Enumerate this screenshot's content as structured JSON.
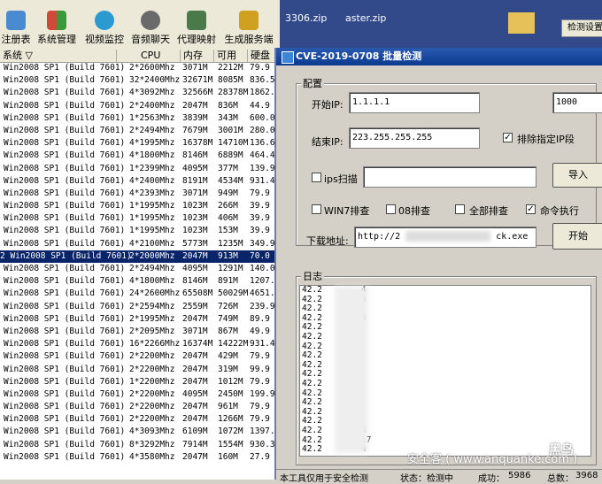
{
  "toolbar": {
    "items": [
      {
        "label": "注册表",
        "icon": "registry-icon",
        "color": "#4a8ad0"
      },
      {
        "label": "系统管理",
        "icon": "windows-logo-icon",
        "color": "#d04a3a"
      },
      {
        "label": "视频监控",
        "icon": "camera-icon",
        "color": "#2a9ad0"
      },
      {
        "label": "音频聊天",
        "icon": "headset-icon",
        "color": "#6a6a6a"
      },
      {
        "label": "代理映射",
        "icon": "proxy-icon",
        "color": "#4a7a4a"
      },
      {
        "label": "生成服务端",
        "icon": "build-icon",
        "color": "#d0a020"
      }
    ]
  },
  "table": {
    "headers": [
      "系统",
      "CPU",
      "内存",
      "可用",
      "硬盘"
    ],
    "sort_indicator": "▽",
    "rows": [
      [
        "Win2008 SP1 (Build 7601)",
        "2*2600Mhz",
        "3071M",
        "2212M",
        "79.9"
      ],
      [
        "Win2008 SP1 (Build 7601)",
        "32*2400Mhz",
        "32671M",
        "8085M",
        "836.5"
      ],
      [
        "Win2008 SP1 (Build 7601)",
        "4*3092Mhz",
        "32566M",
        "28378M",
        "1862.4"
      ],
      [
        "Win2008 SP1 (Build 7601)",
        "2*2400Mhz",
        "2047M",
        "836M",
        "44.9"
      ],
      [
        "Win2008 SP1 (Build 7601)",
        "1*2563Mhz",
        "3839M",
        "343M",
        "600.0"
      ],
      [
        "Win2008 SP1 (Build 7601)",
        "2*2494Mhz",
        "7679M",
        "3001M",
        "280.0"
      ],
      [
        "Win2008 SP1 (Build 7601)",
        "4*1995Mhz",
        "16378M",
        "14710M",
        "136.6"
      ],
      [
        "Win2008 SP1 (Build 7601)",
        "4*1800Mhz",
        "8146M",
        "6889M",
        "464.4"
      ],
      [
        "Win2008 SP1 (Build 7601)",
        "1*2399Mhz",
        "4095M",
        "377M",
        "139.9"
      ],
      [
        "Win2008 SP1 (Build 7601)",
        "4*2400Mhz",
        "8191M",
        "4534M",
        "931.4"
      ],
      [
        "Win2008 SP1 (Build 7601)",
        "4*2393Mhz",
        "3071M",
        "949M",
        "79.9"
      ],
      [
        "Win2008 SP1 (Build 7601)",
        "1*1995Mhz",
        "1023M",
        "266M",
        "39.9"
      ],
      [
        "Win2008 SP1 (Build 7601)",
        "1*1995Mhz",
        "1023M",
        "406M",
        "39.9"
      ],
      [
        "Win2008 SP1 (Build 7601)",
        "1*1995Mhz",
        "1023M",
        "153M",
        "39.9"
      ],
      [
        "Win2008 SP1 (Build 7601)",
        "4*2100Mhz",
        "5773M",
        "1235M",
        "349.9"
      ],
      [
        "2 Win2008 SP1 (Build 7601)",
        "2*2000Mhz",
        "2047M",
        "913M",
        "70.0"
      ],
      [
        "Win2008 SP1 (Build 7601)",
        "2*2494Mhz",
        "4095M",
        "1291M",
        "140.0"
      ],
      [
        "Win2008 SP1 (Build 7601)",
        "4*1800Mhz",
        "8146M",
        "891M",
        "1207.4"
      ],
      [
        "Win2008 SP1 (Build 7601)",
        "24*2600Mhz",
        "65508M",
        "50029M",
        "4651.7"
      ],
      [
        "Win2008 SP1 (Build 7601)",
        "2*2594Mhz",
        "2559M",
        "726M",
        "239.9"
      ],
      [
        "Win2008 SP1 (Build 7601)",
        "2*1995Mhz",
        "2047M",
        "749M",
        "89.9"
      ],
      [
        "Win2008 SP1 (Build 7601)",
        "2*2095Mhz",
        "3071M",
        "867M",
        "49.9"
      ],
      [
        "Win2008 SP1 (Build 7601)",
        "16*2266Mhz",
        "16374M",
        "14222M",
        "931.4"
      ],
      [
        "Win2008 SP1 (Build 7601)",
        "2*2200Mhz",
        "2047M",
        "429M",
        "79.9"
      ],
      [
        "Win2008 SP1 (Build 7601)",
        "2*2200Mhz",
        "2047M",
        "319M",
        "99.9"
      ],
      [
        "Win2008 SP1 (Build 7601)",
        "1*2200Mhz",
        "2047M",
        "1012M",
        "79.9"
      ],
      [
        "Win2008 SP1 (Build 7601)",
        "2*2200Mhz",
        "4095M",
        "2450M",
        "199.9"
      ],
      [
        "Win2008 SP1 (Build 7601)",
        "2*2200Mhz",
        "2047M",
        "961M",
        "79.9"
      ],
      [
        "Win2008 SP1 (Build 7601)",
        "2*2200Mhz",
        "2047M",
        "1266M",
        "79.9"
      ],
      [
        "Win2008 SP1 (Build 7601)",
        "4*3093Mhz",
        "6109M",
        "1072M",
        "1397.2"
      ],
      [
        "Win2008 SP1 (Build 7601)",
        "8*3292Mhz",
        "7914M",
        "1554M",
        "930.3"
      ],
      [
        "Win2008 SP1 (Build 7601)",
        "4*3580Mhz",
        "2047M",
        "160M",
        "27.9"
      ]
    ],
    "selected_row": 15
  },
  "background": {
    "file1": "3306.zip",
    "file2": "aster.zip",
    "tab": "检测设置"
  },
  "dialog": {
    "title": "CVE-2019-0708 批量检测",
    "config_group": "配置",
    "start_ip_label": "开始IP:",
    "start_ip": "1.1.1.1",
    "threads": "1000",
    "end_ip_label": "结束IP:",
    "end_ip": "223.255.255.255",
    "exclude_label": "排除指定IP段",
    "exclude_checked": "✓",
    "ips_scan_label": "ips扫描",
    "import_button": "导入",
    "win7_label": "WIN7排查",
    "win08_label": "08排查",
    "all_label": "全部排查",
    "cmd_label": "命令执行",
    "cmd_checked": "✓",
    "download_label": "下载地址:",
    "download_prefix": "http://2",
    "download_suffix": "ck.exe",
    "start_button": "开始",
    "log_group": "日志",
    "log_lines": [
      "42.2",
      "42.2",
      "42.2",
      "42.2",
      "42.2",
      "42.2",
      "42.2",
      "42.2",
      "42.2",
      "42.2",
      "42.2",
      "42.2",
      "42.2",
      "42.2",
      "42.2",
      "42.2",
      "42.2",
      "42.2"
    ],
    "log_frag": [
      "4",
      "4",
      "",
      "4",
      "",
      "",
      "",
      "",
      "",
      "",
      "",
      "",
      "",
      "",
      "",
      "4",
      "17",
      "4"
    ],
    "status_note": "本工具仅用于安全检测",
    "status_state": "状态：检测中",
    "status_success_label": "成功：",
    "status_success": "5986",
    "status_count_label": "总数：",
    "status_count": "3968"
  },
  "watermark": {
    "site": "安全客 ( www.anquanke.com )",
    "brand": "黑鸟"
  }
}
